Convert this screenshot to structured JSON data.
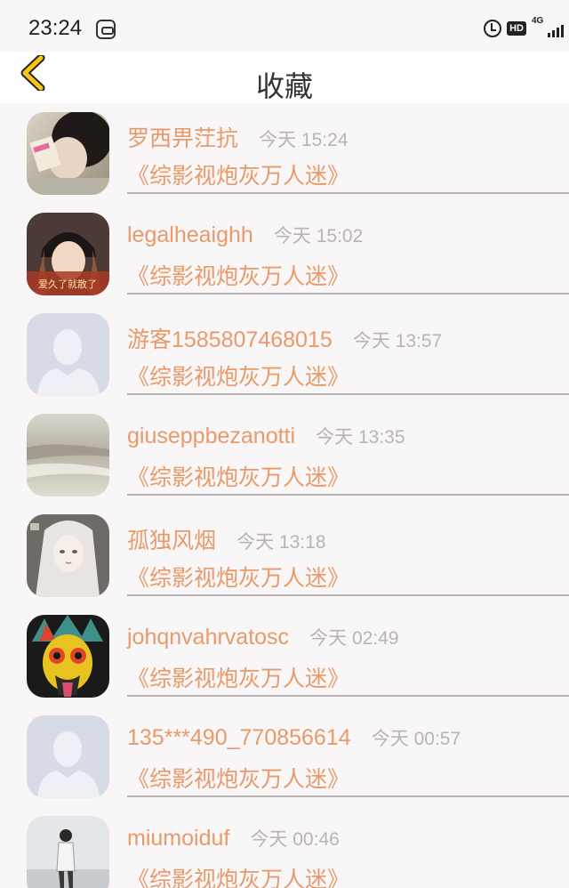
{
  "status_bar": {
    "time": "23:24",
    "app_icon": "screen-recorder-icon",
    "hd_label": "HD",
    "network_label": "4G",
    "icons": [
      "alarm-icon",
      "hd-icon",
      "signal-icon"
    ]
  },
  "nav": {
    "back_icon": "chevron-left-icon",
    "title": "收藏"
  },
  "colors": {
    "accent": "#e89a6a",
    "back_arrow": "#f5c518",
    "muted": "#b8b4b4",
    "background": "#f8f6f6"
  },
  "items": [
    {
      "username": "罗西畀茳抗",
      "time": "今天 15:24",
      "book": "《综影视炮灰万人迷》",
      "avatar": "photo-avatar"
    },
    {
      "username": "legalheaighh",
      "time": "今天 15:02",
      "book": "《综影视炮灰万人迷》",
      "avatar": "photo-avatar",
      "avatar_caption": "爱久了就散了"
    },
    {
      "username": "游客1585807468015",
      "time": "今天 13:57",
      "book": "《综影视炮灰万人迷》",
      "avatar": "default-avatar"
    },
    {
      "username": "giuseppbezanotti",
      "time": "今天 13:35",
      "book": "《综影视炮灰万人迷》",
      "avatar": "sea-avatar"
    },
    {
      "username": "孤独风烟",
      "time": "今天 13:18",
      "book": "《综影视炮灰万人迷》",
      "avatar": "anime-avatar"
    },
    {
      "username": "johqnvahrvatosc",
      "time": "今天 02:49",
      "book": "《综影视炮灰万人迷》",
      "avatar": "art-avatar"
    },
    {
      "username": "135***490_770856614",
      "time": "今天 00:57",
      "book": "《综影视炮灰万人迷》",
      "avatar": "default-avatar"
    },
    {
      "username": "miumoiduf",
      "time": "今天 00:46",
      "book": "《综影视炮灰万人迷》",
      "avatar": "photo-avatar"
    }
  ]
}
